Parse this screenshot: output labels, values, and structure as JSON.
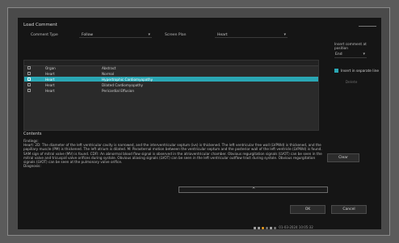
{
  "dialog": {
    "title": "Load Comment"
  },
  "filters": {
    "comment_type_label": "Comment Type",
    "comment_type_value": "Follow",
    "screen_plan_label": "Screen Plan",
    "screen_plan_value": "Heart"
  },
  "table": {
    "rows": [
      {
        "type": "Organ",
        "name": "Abstract",
        "checked": false,
        "selected": false
      },
      {
        "type": "Heart",
        "name": "Normal",
        "checked": false,
        "selected": false
      },
      {
        "type": "Heart",
        "name": "Hypertrophic Cardiomyopathy",
        "checked": false,
        "selected": true
      },
      {
        "type": "Heart",
        "name": "Dilated Cardiomyopathy",
        "checked": false,
        "selected": false
      },
      {
        "type": "Heart",
        "name": "Pericardial Effusion",
        "checked": false,
        "selected": false
      }
    ]
  },
  "right_panel": {
    "insert_label": "Insert comment at position",
    "insert_value": "End",
    "replace_label": "Insert in separate line",
    "ghost_button": "Delete"
  },
  "contents": {
    "label": "Contents",
    "findings_heading": "Findings:",
    "findings_text": "Heart: 2D: The diameter of the left ventricular cavity is narrowed, and the interventricular septum (ivs) is thickened. The left ventricular free wall (LVPWd) is thickened, and the papillary muscle (PM) is thickened. The left atrium is dilated. M: Parasternal motion between the ventricular septum and the posterior wall of the left ventricle (LVPWd) is found. SAM sign of mitral valve (MV) is found. CDFI: An abnormal blood flow signal is observed in the atrioventricular chamber. Obvious regurgitation signals (LVOT) can be seen in the mitral valve and tricuspid valve orifices during systole. Obvious aliasing signals (LVOT) can be seen in the left ventricular outflow tract during systole. Obvious regurgitation signals (LVOT) can be seen at the pulmonary valve orifice.",
    "diagnosis_heading": "Diagnosis:"
  },
  "buttons": {
    "clear": "Clear",
    "ok": "OK",
    "cancel": "Cancel"
  },
  "progress": {
    "marker": "^"
  },
  "footer": {
    "timestamp": "01-03-2024  10:05:32"
  },
  "colors": {
    "accent": "#2aa7b4",
    "footer_dot": "#f0a020"
  }
}
